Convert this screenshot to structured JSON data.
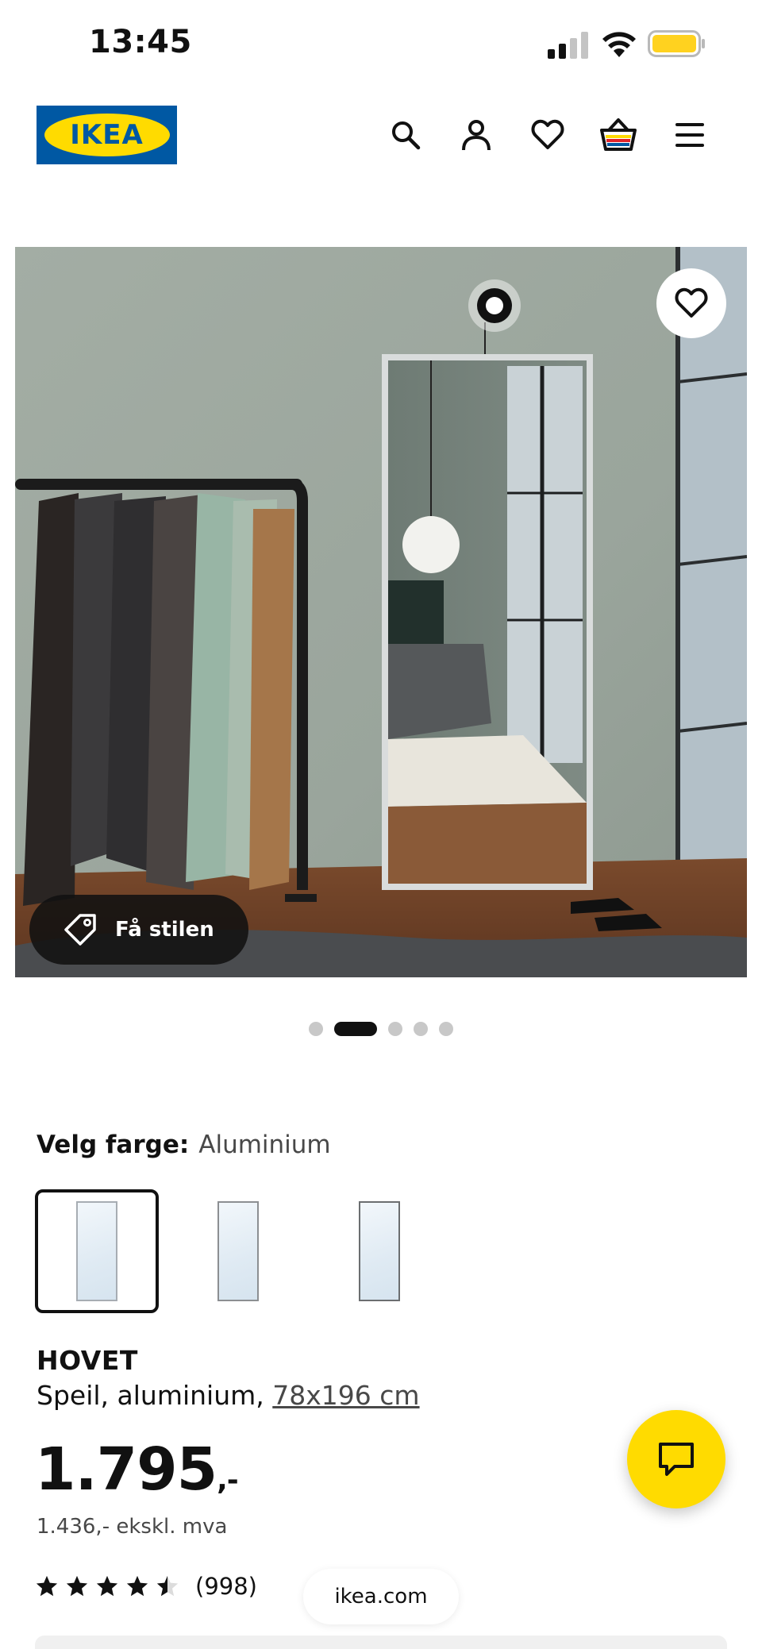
{
  "status_bar": {
    "time": "13:45"
  },
  "header": {
    "logo_text": "IKEA",
    "icons": [
      "search-icon",
      "profile-icon",
      "heart-icon",
      "cart-icon",
      "menu-icon"
    ]
  },
  "hero": {
    "style_button_label": "Få stilen",
    "carousel": {
      "count": 5,
      "active_index": 1
    }
  },
  "color": {
    "label": "Velg farge:",
    "value": "Aluminium",
    "swatches": [
      "Aluminium",
      "Swatch 2",
      "Swatch 3"
    ],
    "selected_index": 0
  },
  "product": {
    "name": "HOVET",
    "description": "Speil, aluminium, ",
    "size": "78x196 cm",
    "price": "1.795",
    "price_suffix": ",-",
    "price_ex_vat": "1.436,- ekskl. mva",
    "rating_value": 4.5,
    "rating_count": "(998)"
  },
  "browser": {
    "domain": "ikea.com"
  },
  "colors": {
    "brand_blue": "#0058a3",
    "brand_yellow": "#ffdb00",
    "text": "#111111"
  }
}
